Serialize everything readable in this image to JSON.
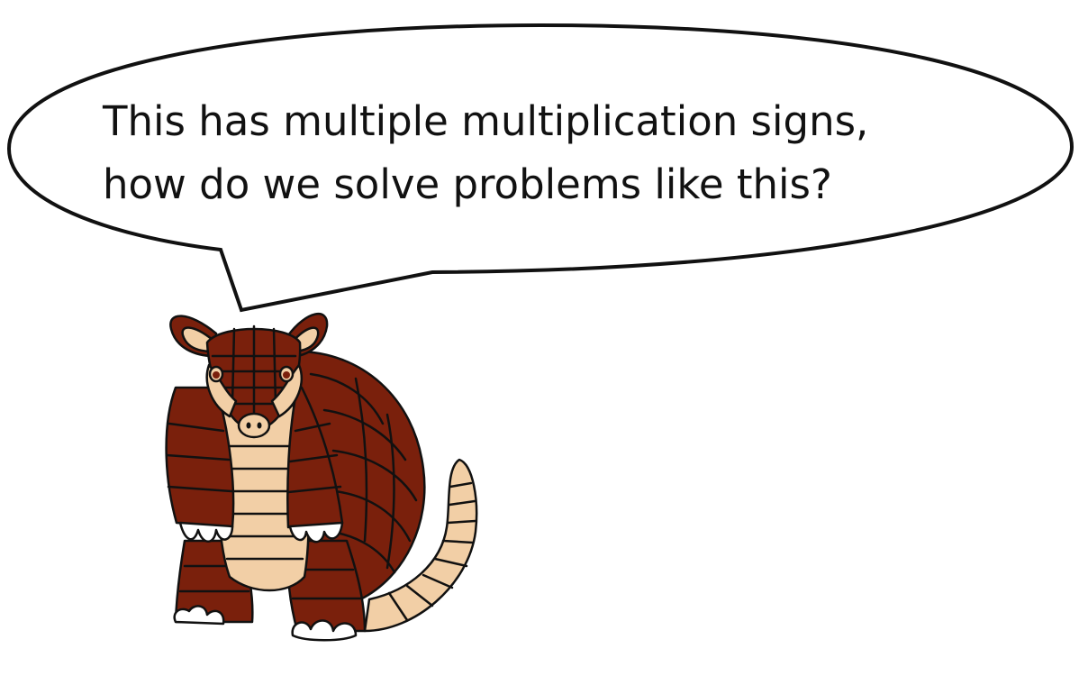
{
  "speech_bubble": {
    "lines": [
      "This has multiple multiplication signs,",
      "how do we solve problems like this?"
    ]
  },
  "character": {
    "kind": "armadillo",
    "colors": {
      "shell": "#7a200c",
      "skin": "#f2cfa6",
      "outline": "#111111"
    }
  },
  "colors": {
    "background": "#ffffff",
    "bubble_fill": "#ffffff",
    "bubble_stroke": "#111111",
    "text": "#111111"
  }
}
